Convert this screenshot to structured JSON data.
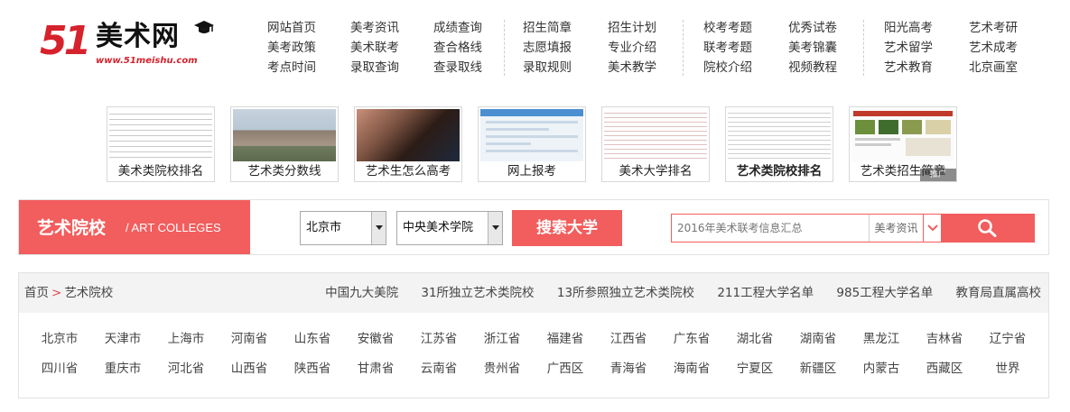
{
  "logo": {
    "mark": "51",
    "name": "美术网",
    "url": "www.51meishu.com"
  },
  "nav": {
    "columns": [
      [
        "网站首页",
        "美考政策",
        "考点时间"
      ],
      [
        "美考资讯",
        "美术联考",
        "录取查询"
      ],
      [
        "成绩查询",
        "查合格线",
        "查录取线"
      ],
      [
        "招生简章",
        "志愿填报",
        "录取规则"
      ],
      [
        "招生计划",
        "专业介绍",
        "美术教学"
      ],
      [
        "校考考题",
        "联考考题",
        "院校介绍"
      ],
      [
        "优秀试卷",
        "美考锦囊",
        "视频教程"
      ],
      [
        "阳光高考",
        "艺术留学",
        "艺术教育"
      ],
      [
        "艺术考研",
        "艺术成考",
        "北京画室"
      ]
    ]
  },
  "thumbs": [
    {
      "caption": "美术类院校排名",
      "image": "table-image",
      "bold": false
    },
    {
      "caption": "艺术类分数线",
      "image": "campus-image",
      "bold": false
    },
    {
      "caption": "艺术生怎么高考",
      "image": "student-photo",
      "bold": false
    },
    {
      "caption": "网上报考",
      "image": "website-screenshot",
      "bold": false
    },
    {
      "caption": "美术大学排名",
      "image": "ranking-table-image",
      "bold": false
    },
    {
      "caption": "艺术类院校排名",
      "image": "list-image",
      "bold": true
    },
    {
      "caption": "艺术类招生简章",
      "image": "news-collage-image",
      "bold": false,
      "ad_tag": "推广"
    }
  ],
  "search": {
    "title_cn": "艺术院校",
    "title_en": "/ ART COLLEGES",
    "city_select": "北京市",
    "school_select": "中央美术学院",
    "search_button": "搜索大学",
    "keyword_placeholder": "2016年美术联考信息汇总",
    "category": "美考资讯"
  },
  "breadcrumb": {
    "home": "首页",
    "separator": ">",
    "current": "艺术院校"
  },
  "quick_links": [
    "中国九大美院",
    "31所独立艺术类院校",
    "13所参照独立艺术类院校",
    "211工程大学名单",
    "985工程大学名单",
    "教育局直属高校"
  ],
  "provinces": [
    [
      "北京市",
      "天津市",
      "上海市",
      "河南省",
      "山东省",
      "安徽省",
      "江苏省",
      "浙江省",
      "福建省",
      "江西省",
      "广东省",
      "湖北省",
      "湖南省",
      "黑龙江",
      "吉林省",
      "辽宁省"
    ],
    [
      "四川省",
      "重庆市",
      "河北省",
      "山西省",
      "陕西省",
      "甘肃省",
      "云南省",
      "贵州省",
      "广西区",
      "青海省",
      "海南省",
      "宁夏区",
      "新疆区",
      "内蒙古",
      "西藏区",
      "世界"
    ]
  ],
  "colors": {
    "brand_red": "#f25d5d",
    "logo_red": "#d6222c"
  }
}
